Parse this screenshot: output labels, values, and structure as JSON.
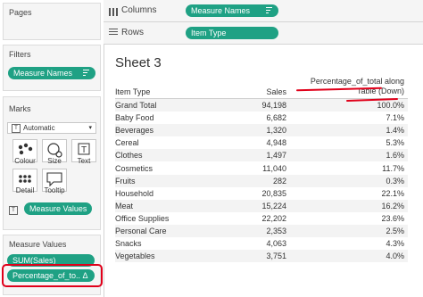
{
  "left_panel": {
    "pages_title": "Pages",
    "filters_title": "Filters",
    "filters_pill": "Measure Names",
    "marks_title": "Marks",
    "marks_type": "Automatic",
    "marks_buttons": [
      "Colour",
      "Size",
      "Text",
      "Detail",
      "Tooltip"
    ],
    "marks_pill": "Measure Values",
    "measure_values_title": "Measure Values",
    "measure_values_pills": [
      "SUM(Sales)",
      "Percentage_of_to.. Δ"
    ]
  },
  "shelves": {
    "columns_label": "Columns",
    "columns_pill": "Measure Names",
    "rows_label": "Rows",
    "rows_pill": "Item Type"
  },
  "sheet": {
    "title": "Sheet 3",
    "headers": {
      "item_type": "Item Type",
      "sales": "Sales",
      "pct_line1": "Percentage_of_total along",
      "pct_line2": "Table (Down)"
    },
    "rows": [
      {
        "item": "Grand Total",
        "sales": "94,198",
        "pct": "100.0%"
      },
      {
        "item": "Baby Food",
        "sales": "6,682",
        "pct": "7.1%"
      },
      {
        "item": "Beverages",
        "sales": "1,320",
        "pct": "1.4%"
      },
      {
        "item": "Cereal",
        "sales": "4,948",
        "pct": "5.3%"
      },
      {
        "item": "Clothes",
        "sales": "1,497",
        "pct": "1.6%"
      },
      {
        "item": "Cosmetics",
        "sales": "11,040",
        "pct": "11.7%"
      },
      {
        "item": "Fruits",
        "sales": "282",
        "pct": "0.3%"
      },
      {
        "item": "Household",
        "sales": "20,835",
        "pct": "22.1%"
      },
      {
        "item": "Meat",
        "sales": "15,224",
        "pct": "16.2%"
      },
      {
        "item": "Office Supplies",
        "sales": "22,202",
        "pct": "23.6%"
      },
      {
        "item": "Personal Care",
        "sales": "2,353",
        "pct": "2.5%"
      },
      {
        "item": "Snacks",
        "sales": "4,063",
        "pct": "4.3%"
      },
      {
        "item": "Vegetables",
        "sales": "3,751",
        "pct": "4.0%"
      }
    ]
  },
  "colors": {
    "pill_green": "#1fa184",
    "annotation_red": "#e0001a"
  }
}
